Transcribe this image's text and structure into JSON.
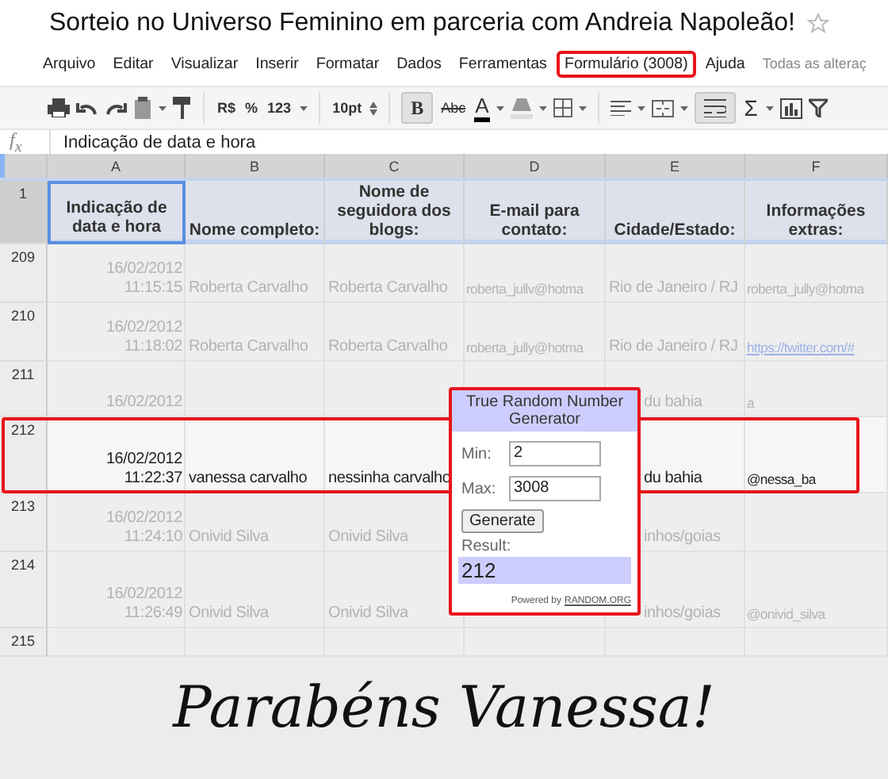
{
  "document": {
    "title": "Sorteio no Universo Feminino em parceria com Andreia Napoleão!",
    "starred": false
  },
  "menu": [
    {
      "label": "Arquivo",
      "highlighted": false
    },
    {
      "label": "Editar",
      "highlighted": false
    },
    {
      "label": "Visualizar",
      "highlighted": false
    },
    {
      "label": "Inserir",
      "highlighted": false
    },
    {
      "label": "Formatar",
      "highlighted": false
    },
    {
      "label": "Dados",
      "highlighted": false
    },
    {
      "label": "Ferramentas",
      "highlighted": false
    },
    {
      "label": "Formulário (3008)",
      "highlighted": true
    },
    {
      "label": "Ajuda",
      "highlighted": false
    }
  ],
  "save_status": "Todas as alteraç",
  "toolbar": {
    "currency": "R$",
    "percent": "%",
    "number_format": "123",
    "font_size": "10pt",
    "bold": {
      "label": "B",
      "selected": true
    },
    "strikethrough": "Abc",
    "text_color": "A",
    "wrap": {
      "selected": true
    },
    "sum": "Σ"
  },
  "formula_bar": {
    "label": "f$_{x}$",
    "value": "Indicação de data e hora"
  },
  "columns": [
    "A",
    "B",
    "C",
    "D",
    "E",
    "F"
  ],
  "header_row": {
    "number": "1",
    "cells": [
      {
        "text": "Indicação de data e hora",
        "selected": true
      },
      {
        "text": "Nome completo:",
        "selected": false
      },
      {
        "text": "Nome de seguidora dos blogs:",
        "selected": false
      },
      {
        "text": "E-mail para contato:",
        "selected": false
      },
      {
        "text": "Cidade/Estado:",
        "selected": false
      },
      {
        "text": "Informações extras:",
        "selected": false
      }
    ]
  },
  "rows": [
    {
      "number": "209",
      "dimmed": true,
      "highlighted": false,
      "cells": [
        {
          "text": "16/02/2012 11:15:15"
        },
        {
          "text": "Roberta Carvalho"
        },
        {
          "text": "Roberta Carvalho"
        },
        {
          "text": "roberta_jullv@hotma"
        },
        {
          "text": "Rio de Janeiro / RJ"
        },
        {
          "text": "roberta_jully@hotma"
        }
      ]
    },
    {
      "number": "210",
      "dimmed": true,
      "highlighted": false,
      "cells": [
        {
          "text": "16/02/2012 11:18:02"
        },
        {
          "text": "Roberta Carvalho"
        },
        {
          "text": "Roberta Carvalho"
        },
        {
          "text": "roberta_jully@hotma"
        },
        {
          "text": "Rio de Janeiro / RJ"
        },
        {
          "text": "https://twitter.com/#",
          "link": true
        }
      ]
    },
    {
      "number": "211",
      "dimmed": true,
      "highlighted": false,
      "cells": [
        {
          "text": "16/02/2012"
        },
        {
          "text": ""
        },
        {
          "text": ""
        },
        {
          "text": ""
        },
        {
          "text": "du bahia",
          "covered": true
        },
        {
          "text": "a"
        }
      ]
    },
    {
      "number": "212",
      "dimmed": false,
      "highlighted": true,
      "cells": [
        {
          "text": "16/02/2012 11:22:37"
        },
        {
          "text": "vanessa carvalho"
        },
        {
          "text": "nessinha carvalho"
        },
        {
          "text": ""
        },
        {
          "text": "du bahia",
          "covered": true
        },
        {
          "text": "@nessa_ba"
        }
      ]
    },
    {
      "number": "213",
      "dimmed": true,
      "highlighted": false,
      "cells": [
        {
          "text": "16/02/2012 11:24:10"
        },
        {
          "text": "Onivid Silva"
        },
        {
          "text": "Onivid Silva"
        },
        {
          "text": ""
        },
        {
          "text": "inhos/goias",
          "covered": true
        },
        {
          "text": ""
        }
      ]
    },
    {
      "number": "214",
      "dimmed": true,
      "highlighted": false,
      "cells": [
        {
          "text": "16/02/2012 11:26:49"
        },
        {
          "text": "Onivid Silva"
        },
        {
          "text": "Onivid Silva"
        },
        {
          "text": ""
        },
        {
          "text": "inhos/goias",
          "covered": true
        },
        {
          "text": "@onivid_silva"
        }
      ]
    },
    {
      "number": "215",
      "dimmed": true,
      "highlighted": false,
      "cells": []
    }
  ],
  "random_generator": {
    "title": "True Random Number Generator",
    "highlighted": true,
    "min_label": "Min:",
    "min": "2",
    "max_label": "Max:",
    "max": "3008",
    "button": "Generate",
    "result_label": "Result:",
    "result": "212",
    "footer": "Powered by",
    "footer_link": "RANDOM.ORG"
  },
  "banner": "Parabéns Vanessa!"
}
